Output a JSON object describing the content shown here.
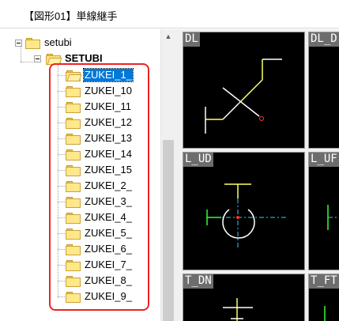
{
  "window": {
    "title": "【図形01】単線継手"
  },
  "tree": {
    "root": {
      "label": "setubi"
    },
    "child": {
      "label": "SETUBI"
    },
    "items": [
      {
        "label": "ZUKEI_1_",
        "selected": true
      },
      {
        "label": "ZUKEI_10"
      },
      {
        "label": "ZUKEI_11"
      },
      {
        "label": "ZUKEI_12"
      },
      {
        "label": "ZUKEI_13"
      },
      {
        "label": "ZUKEI_14"
      },
      {
        "label": "ZUKEI_15"
      },
      {
        "label": "ZUKEI_2_"
      },
      {
        "label": "ZUKEI_3_"
      },
      {
        "label": "ZUKEI_4_"
      },
      {
        "label": "ZUKEI_5_"
      },
      {
        "label": "ZUKEI_6_"
      },
      {
        "label": "ZUKEI_7_"
      },
      {
        "label": "ZUKEI_8_"
      },
      {
        "label": "ZUKEI_9_"
      }
    ]
  },
  "thumbnails": [
    {
      "label": "DL"
    },
    {
      "label": "DL_D"
    },
    {
      "label": "L_UD"
    },
    {
      "label": "L_UF"
    },
    {
      "label": "T_DN"
    },
    {
      "label": "T_FT"
    }
  ],
  "colors": {
    "selection": "#0078d7",
    "annotation": "#ee2222",
    "symbol_white": "#ffffff",
    "symbol_yellow": "#ffff66",
    "symbol_green": "#33ff33",
    "symbol_cyan": "#33ccff",
    "symbol_red": "#ff3333"
  }
}
